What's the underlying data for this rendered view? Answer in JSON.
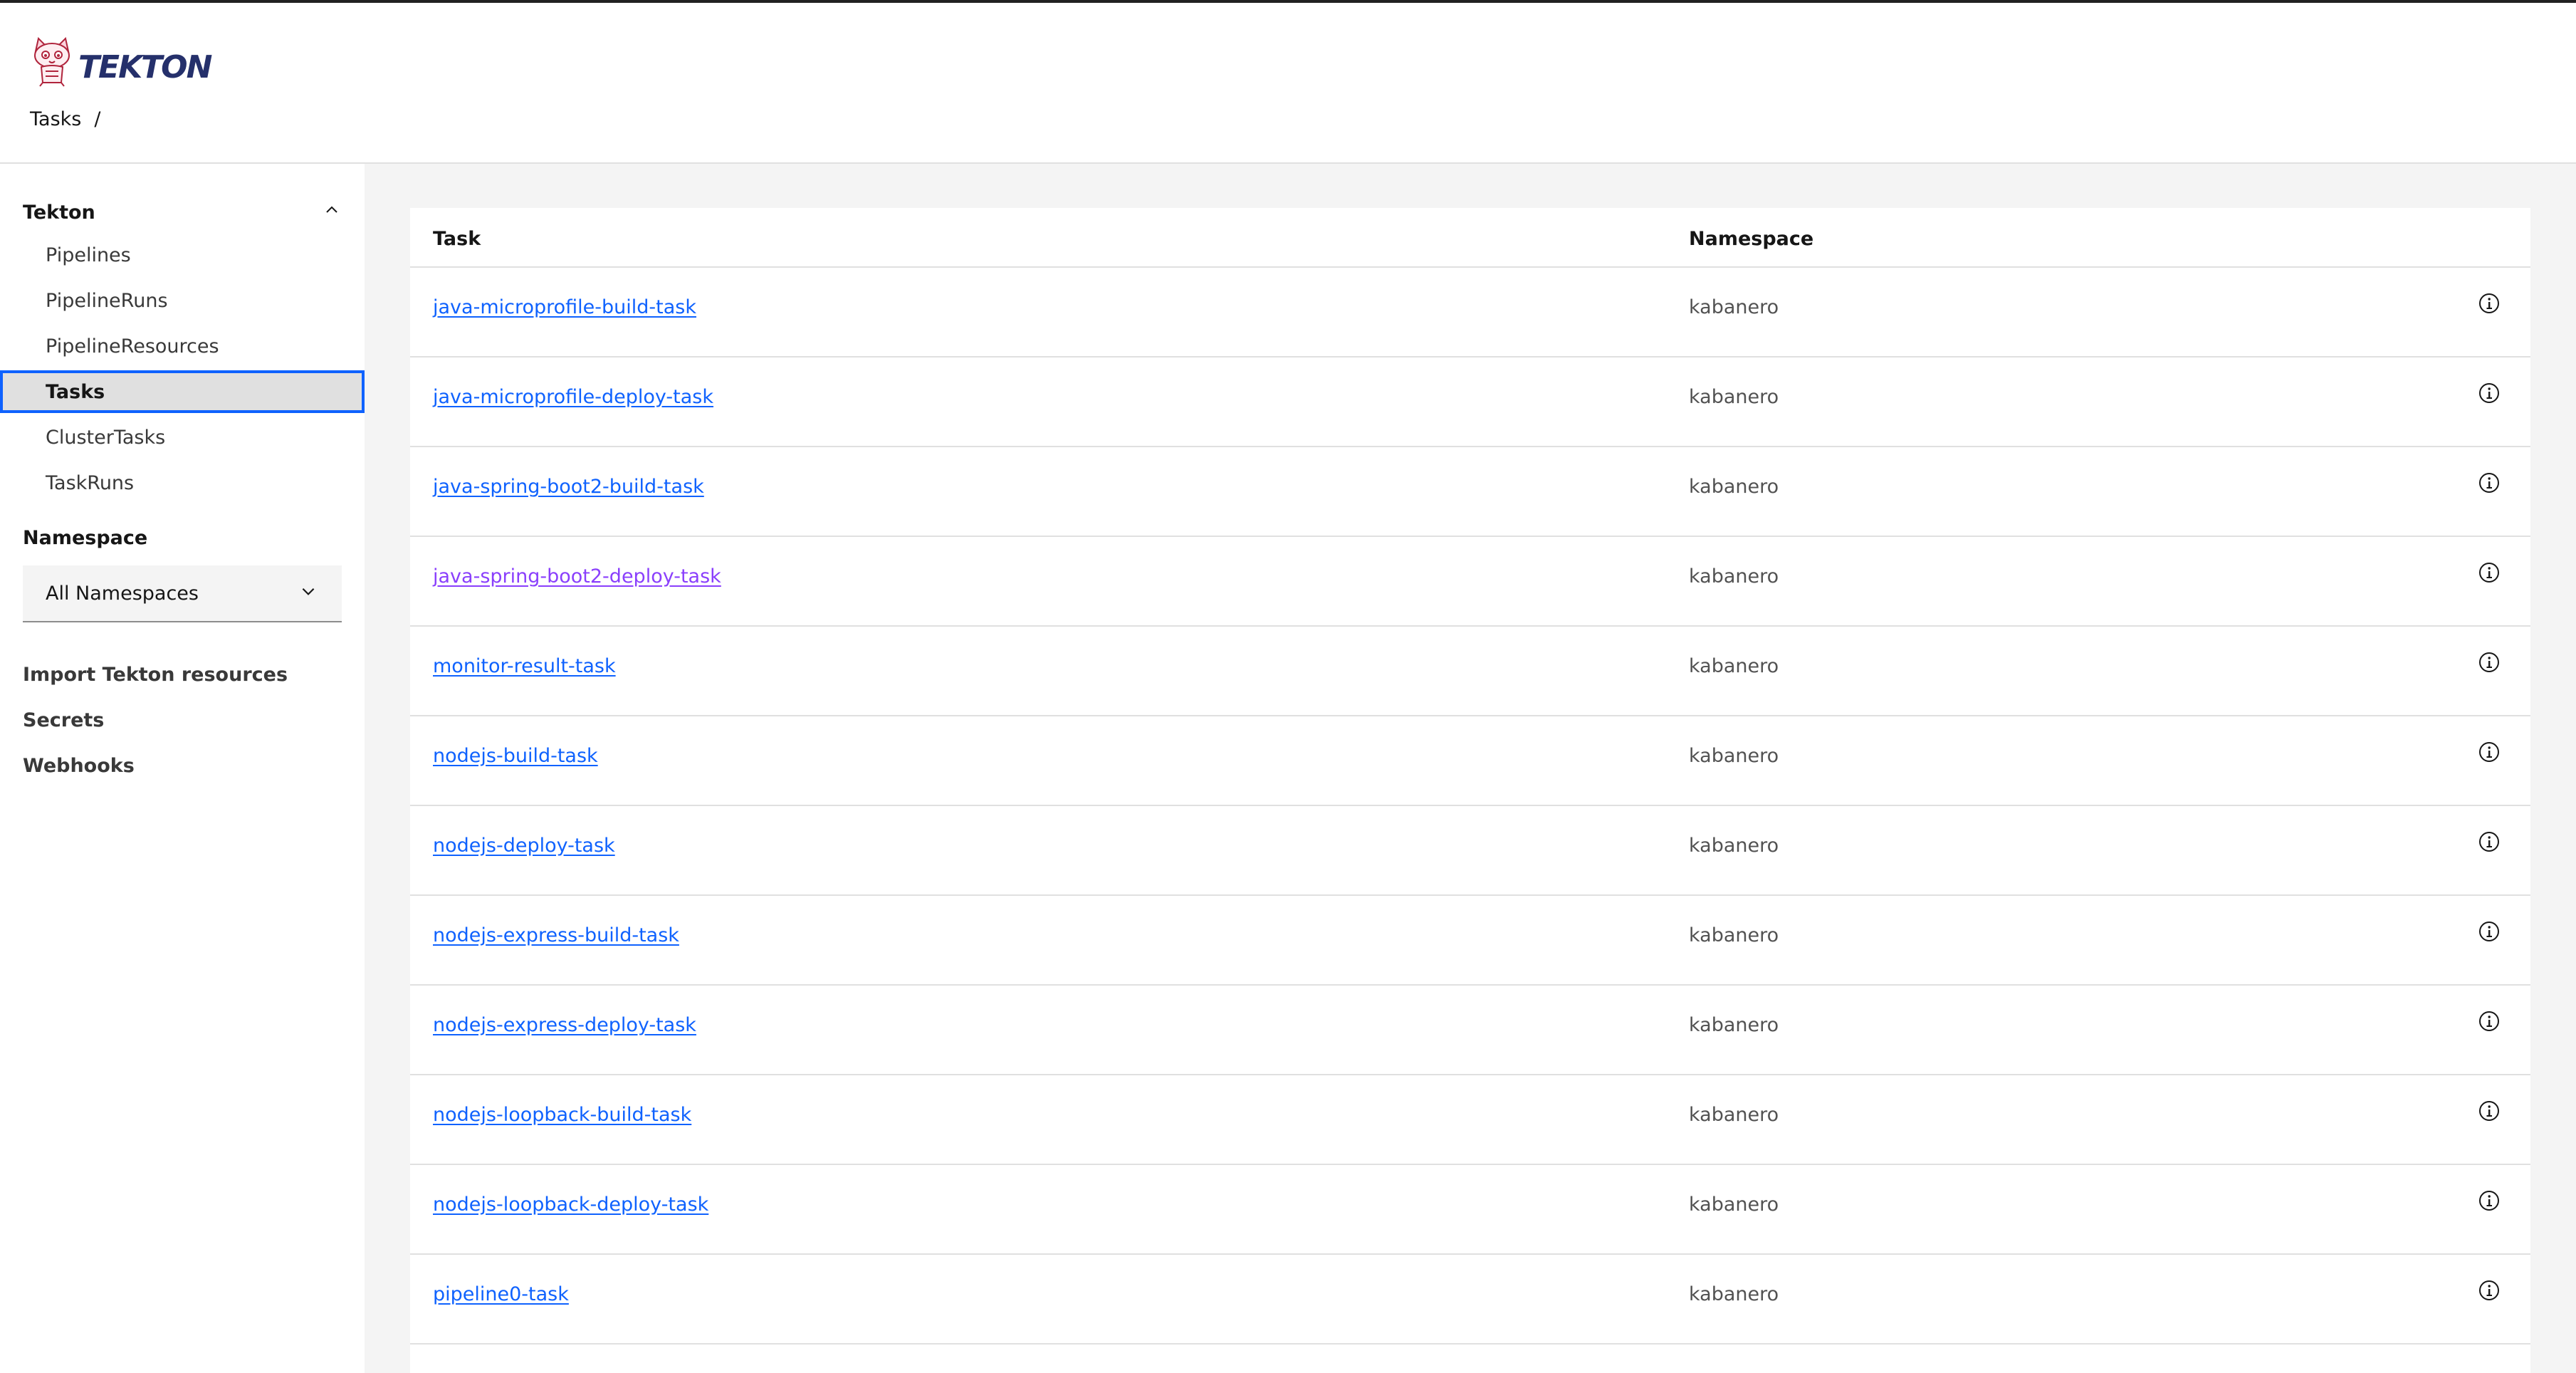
{
  "header": {
    "logo_text": "TEKTON",
    "breadcrumb": {
      "item": "Tasks",
      "separator": "/"
    }
  },
  "sidebar": {
    "section_title": "Tekton",
    "items": [
      {
        "label": "Pipelines"
      },
      {
        "label": "PipelineRuns"
      },
      {
        "label": "PipelineResources"
      },
      {
        "label": "Tasks",
        "active": true
      },
      {
        "label": "ClusterTasks"
      },
      {
        "label": "TaskRuns"
      }
    ],
    "namespace_label": "Namespace",
    "namespace_value": "All Namespaces",
    "links": [
      {
        "label": "Import Tekton resources"
      },
      {
        "label": "Secrets"
      },
      {
        "label": "Webhooks"
      }
    ]
  },
  "table": {
    "headers": {
      "task": "Task",
      "namespace": "Namespace"
    },
    "rows": [
      {
        "task": "java-microprofile-build-task",
        "namespace": "kabanero"
      },
      {
        "task": "java-microprofile-deploy-task",
        "namespace": "kabanero"
      },
      {
        "task": "java-spring-boot2-build-task",
        "namespace": "kabanero"
      },
      {
        "task": "java-spring-boot2-deploy-task",
        "namespace": "kabanero"
      },
      {
        "task": "monitor-result-task",
        "namespace": "kabanero"
      },
      {
        "task": "nodejs-build-task",
        "namespace": "kabanero"
      },
      {
        "task": "nodejs-deploy-task",
        "namespace": "kabanero"
      },
      {
        "task": "nodejs-express-build-task",
        "namespace": "kabanero"
      },
      {
        "task": "nodejs-express-deploy-task",
        "namespace": "kabanero"
      },
      {
        "task": "nodejs-loopback-build-task",
        "namespace": "kabanero"
      },
      {
        "task": "nodejs-loopback-deploy-task",
        "namespace": "kabanero"
      },
      {
        "task": "pipeline0-task",
        "namespace": "kabanero"
      }
    ]
  },
  "icons": {
    "logo": "tekton-cat-logo-icon",
    "collapse": "chevron-up-icon",
    "dropdown": "chevron-down-icon",
    "row_action": "information-icon"
  },
  "colors": {
    "link": "#0f62fe",
    "link_visited": "#8a3ffc",
    "active_border": "#0f62fe",
    "logo_text": "#25306b"
  }
}
